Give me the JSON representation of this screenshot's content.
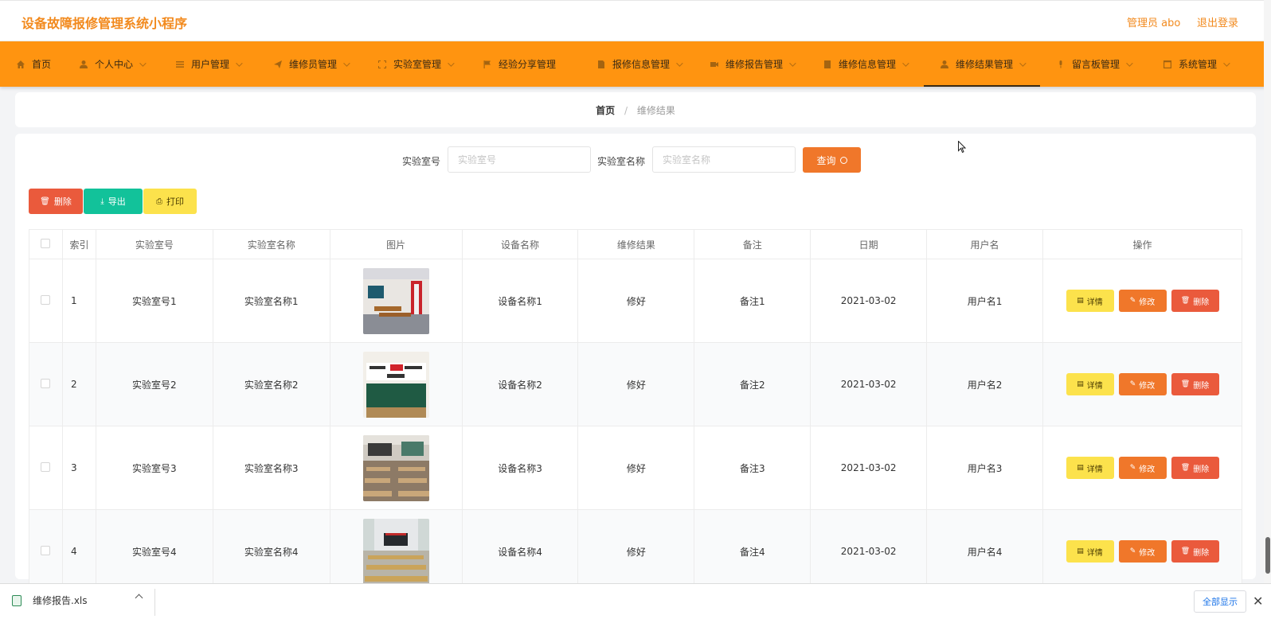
{
  "header": {
    "title": "设备故障报修管理系统小程序",
    "admin": "管理员 abo",
    "logout": "退出登录"
  },
  "nav": {
    "items": [
      {
        "label": "首页",
        "icon": "home-icon"
      },
      {
        "label": "个人中心",
        "icon": "user-icon"
      },
      {
        "label": "用户管理",
        "icon": "list-icon"
      },
      {
        "label": "维修员管理",
        "icon": "send-icon"
      },
      {
        "label": "实验室管理",
        "icon": "frame-icon"
      },
      {
        "label": "经验分享管理",
        "icon": "flag-icon"
      },
      {
        "label": "报修信息管理",
        "icon": "doc-icon"
      },
      {
        "label": "维修报告管理",
        "icon": "video-icon"
      },
      {
        "label": "维修信息管理",
        "icon": "doc-icon"
      },
      {
        "label": "维修结果管理",
        "icon": "user-icon"
      },
      {
        "label": "留言板管理",
        "icon": "mic-icon"
      },
      {
        "label": "系统管理",
        "icon": "window-icon"
      }
    ],
    "active": "维修结果管理"
  },
  "breadcrumb": {
    "home": "首页",
    "separator": "/",
    "current": "维修结果"
  },
  "search": {
    "lab_no_label": "实验室号",
    "lab_no_placeholder": "实验室号",
    "lab_name_label": "实验室名称",
    "lab_name_placeholder": "实验室名称",
    "query_label": "查询"
  },
  "toolbar": {
    "delete_label": "删除",
    "export_label": "导出",
    "print_label": "打印"
  },
  "table": {
    "columns": [
      "索引",
      "实验室号",
      "实验室名称",
      "图片",
      "设备名称",
      "维修结果",
      "备注",
      "日期",
      "用户名",
      "操作"
    ],
    "rows": [
      {
        "index": "1",
        "lab_no": "实验室号1",
        "lab_name": "实验室名称1",
        "device": "设备名称1",
        "result": "修好",
        "note": "备注1",
        "date": "2021-03-02",
        "user": "用户名1"
      },
      {
        "index": "2",
        "lab_no": "实验室号2",
        "lab_name": "实验室名称2",
        "device": "设备名称2",
        "result": "修好",
        "note": "备注2",
        "date": "2021-03-02",
        "user": "用户名2"
      },
      {
        "index": "3",
        "lab_no": "实验室号3",
        "lab_name": "实验室名称3",
        "device": "设备名称3",
        "result": "修好",
        "note": "备注3",
        "date": "2021-03-02",
        "user": "用户名3"
      },
      {
        "index": "4",
        "lab_no": "实验室号4",
        "lab_name": "实验室名称4",
        "device": "设备名称4",
        "result": "修好",
        "note": "备注4",
        "date": "2021-03-02",
        "user": "用户名4"
      }
    ],
    "actions": {
      "detail": "详情",
      "edit": "修改",
      "delete": "删除"
    }
  },
  "download_bar": {
    "file_name": "维修报告.xls",
    "show_all": "全部显示"
  },
  "colors": {
    "brand": "#ff9410",
    "accent": "#f0772a",
    "title": "#f28a1e",
    "export": "#12c29a",
    "print": "#fce24c",
    "danger": "#ea5a3c"
  }
}
